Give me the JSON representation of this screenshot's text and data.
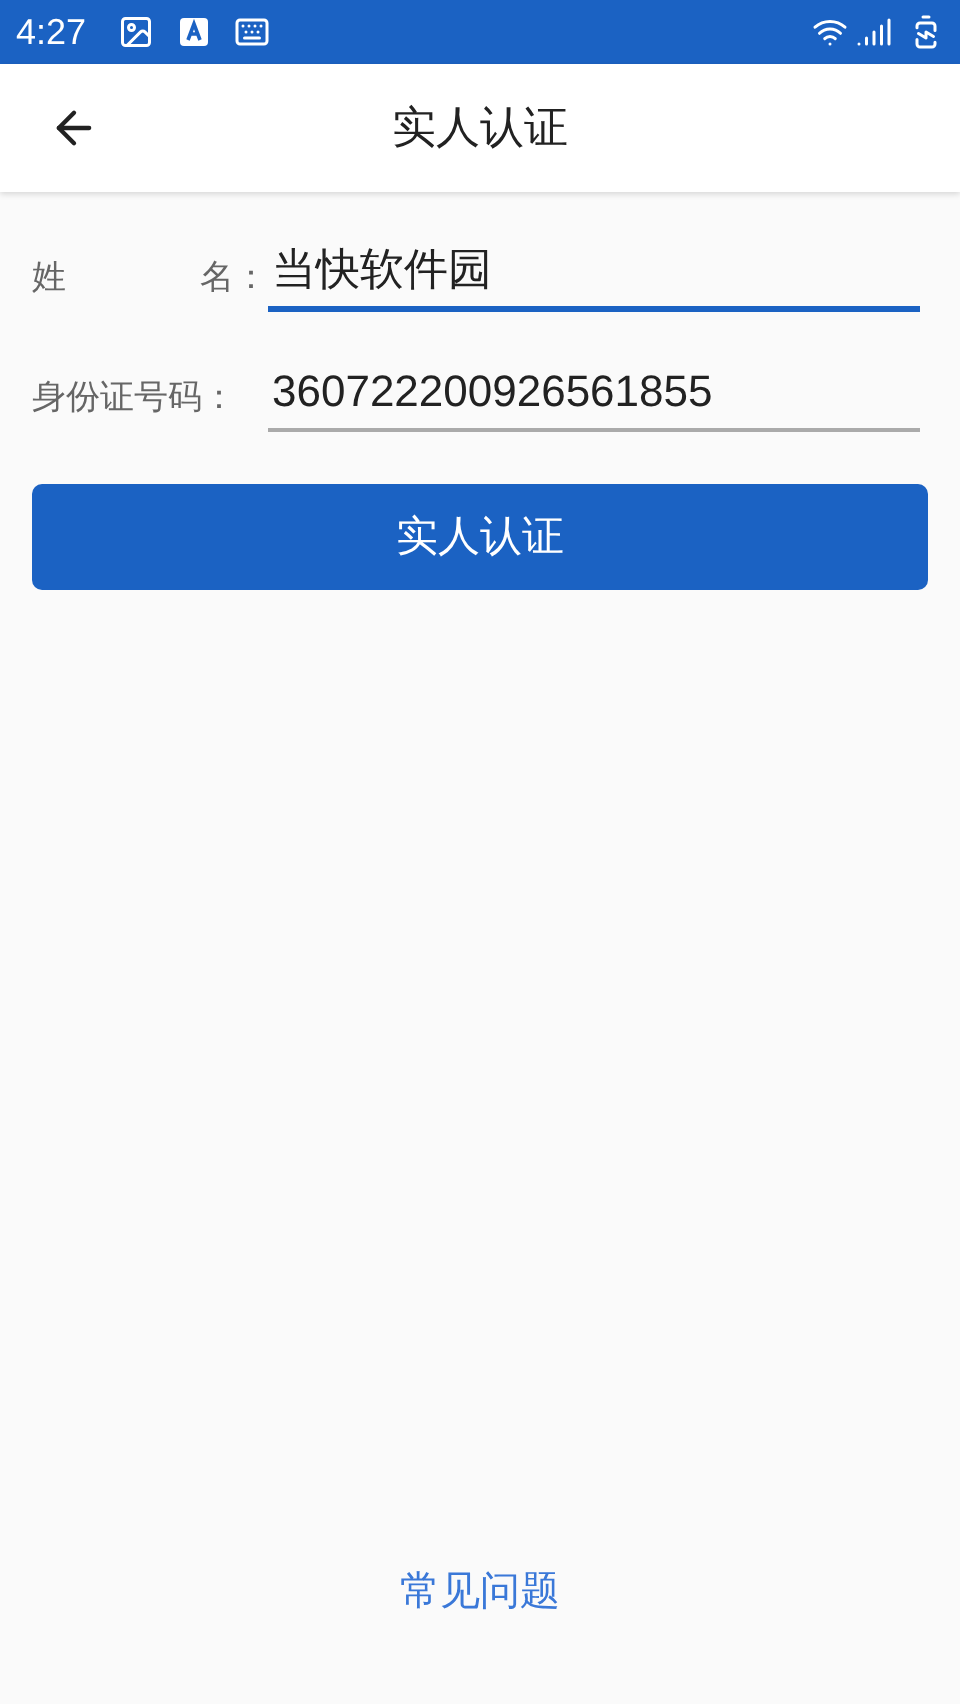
{
  "status_bar": {
    "time": "4:27"
  },
  "header": {
    "title": "实人认证"
  },
  "fields": [
    {
      "label_parts": [
        "姓",
        "名："
      ],
      "value": "当快软件园",
      "focused": true
    },
    {
      "label_parts": [
        "身份证号码："
      ],
      "value": "360722200926561855",
      "focused": false
    }
  ],
  "submit_button": "实人认证",
  "faq_link": "常见问题"
}
